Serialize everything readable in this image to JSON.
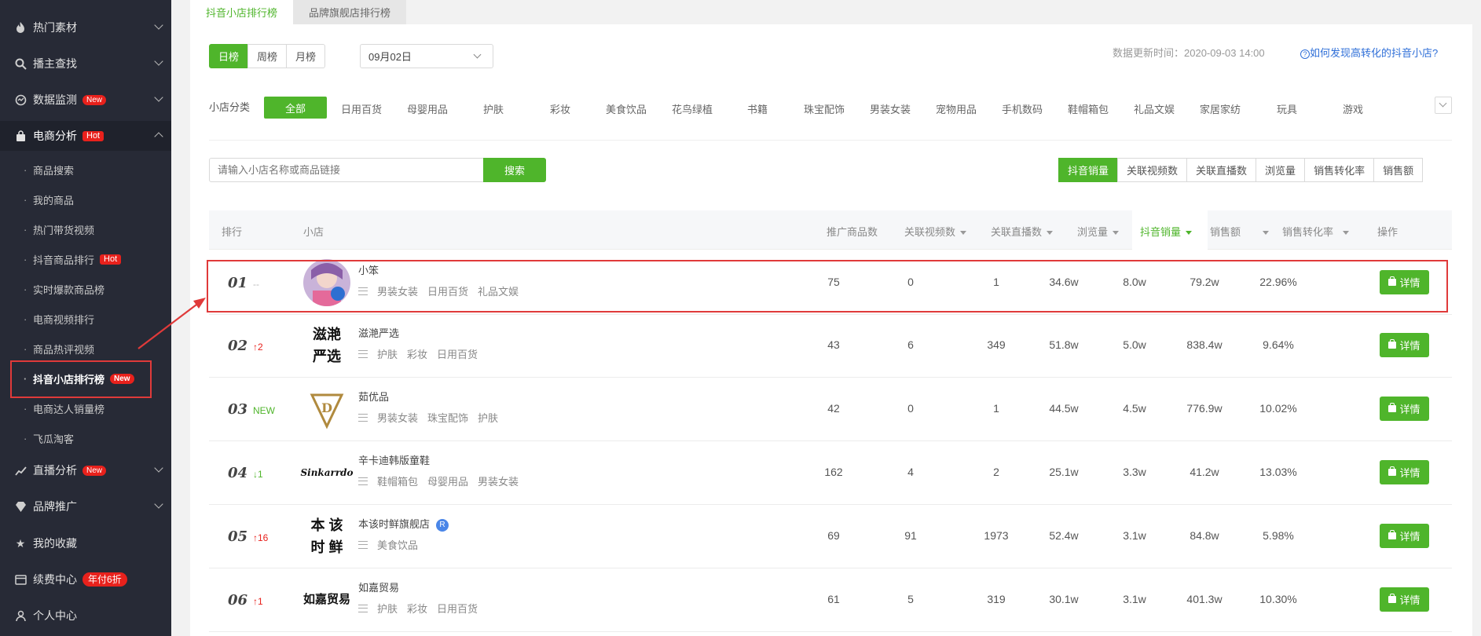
{
  "sidebar": {
    "items": [
      {
        "label": "热门素材",
        "icon": "flame-icon"
      },
      {
        "label": "播主查找",
        "icon": "search-icon"
      },
      {
        "label": "数据监测",
        "icon": "monitor-icon",
        "tag": "New"
      },
      {
        "label": "电商分析",
        "icon": "shopping-bag-icon",
        "tag": "Hot"
      }
    ],
    "sub_items": [
      {
        "label": "商品搜索"
      },
      {
        "label": "我的商品"
      },
      {
        "label": "热门带货视频"
      },
      {
        "label": "抖音商品排行",
        "tag": "Hot"
      },
      {
        "label": "实时爆款商品榜"
      },
      {
        "label": "电商视频排行"
      },
      {
        "label": "商品热评视频"
      },
      {
        "label": "抖音小店排行榜",
        "tag": "New"
      },
      {
        "label": "电商达人销量榜"
      },
      {
        "label": "飞瓜淘客"
      }
    ],
    "bottom_items": [
      {
        "label": "直播分析",
        "icon": "chart-line-icon",
        "tag": "New"
      },
      {
        "label": "品牌推广",
        "icon": "diamond-icon"
      },
      {
        "label": "我的收藏",
        "icon": "star-icon"
      },
      {
        "label": "续费中心",
        "icon": "card-icon",
        "tag": "年付6折"
      },
      {
        "label": "个人中心",
        "icon": "user-icon"
      }
    ]
  },
  "tabs": [
    "抖音小店排行榜",
    "品牌旗舰店排行榜"
  ],
  "period": {
    "options": [
      "日榜",
      "周榜",
      "月榜"
    ],
    "selected": "日榜"
  },
  "date": "09月02日",
  "update_time": "数据更新时间：2020-09-03 14:00",
  "help_link": "如何发现高转化的抖音小店?",
  "category": {
    "label": "小店分类",
    "all": "全部",
    "items": [
      "日用百货",
      "母婴用品",
      "护肤",
      "彩妆",
      "美食饮品",
      "花鸟绿植",
      "书籍",
      "珠宝配饰",
      "男装女装",
      "宠物用品",
      "手机数码",
      "鞋帽箱包",
      "礼品文娱",
      "家居家纺",
      "玩具",
      "游戏"
    ]
  },
  "search": {
    "placeholder": "请输入小店名称或商品链接",
    "button": "搜索"
  },
  "metric_tabs": [
    "抖音销量",
    "关联视频数",
    "关联直播数",
    "浏览量",
    "销售转化率",
    "销售额"
  ],
  "columns": {
    "rank": "排行",
    "shop": "小店",
    "promo": "推广商品数",
    "videos": "关联视频数",
    "lives": "关联直播数",
    "views": "浏览量",
    "sales": "抖音销量",
    "revenue": "销售额",
    "conversion": "销售转化率",
    "action": "操作"
  },
  "detail_label": "详情",
  "rows": [
    {
      "rank": "01",
      "trend": "--",
      "trend_type": "none",
      "name": "小笨",
      "logo_text": "",
      "tags": [
        "男装女装",
        "日用百货",
        "礼品文娱"
      ],
      "promo": "75",
      "videos": "0",
      "lives": "1",
      "views": "34.6w",
      "sales": "8.0w",
      "revenue": "79.2w",
      "conversion": "22.96%"
    },
    {
      "rank": "02",
      "trend": "↑2",
      "trend_type": "up",
      "name": "滋滟严选",
      "logo_text": "滋滟\n严选",
      "tags": [
        "护肤",
        "彩妆",
        "日用百货"
      ],
      "promo": "43",
      "videos": "6",
      "lives": "349",
      "views": "51.8w",
      "sales": "5.0w",
      "revenue": "838.4w",
      "conversion": "9.64%"
    },
    {
      "rank": "03",
      "trend": "NEW",
      "trend_type": "new",
      "name": "茹优品",
      "logo_text": "",
      "tags": [
        "男装女装",
        "珠宝配饰",
        "护肤"
      ],
      "promo": "42",
      "videos": "0",
      "lives": "1",
      "views": "44.5w",
      "sales": "4.5w",
      "revenue": "776.9w",
      "conversion": "10.02%"
    },
    {
      "rank": "04",
      "trend": "↓1",
      "trend_type": "down",
      "name": "辛卡迪韩版童鞋",
      "logo_text": "Sinkarrdo",
      "tags": [
        "鞋帽箱包",
        "母婴用品",
        "男装女装"
      ],
      "promo": "162",
      "videos": "4",
      "lives": "2",
      "views": "25.1w",
      "sales": "3.3w",
      "revenue": "41.2w",
      "conversion": "13.03%"
    },
    {
      "rank": "05",
      "trend": "↑16",
      "trend_type": "up",
      "name": "本该时鲜旗舰店",
      "logo_text": "本 该\n时 鲜",
      "verified": "R",
      "tags": [
        "美食饮品"
      ],
      "promo": "69",
      "videos": "91",
      "lives": "1973",
      "views": "52.4w",
      "sales": "3.1w",
      "revenue": "84.8w",
      "conversion": "5.98%"
    },
    {
      "rank": "06",
      "trend": "↑1",
      "trend_type": "up",
      "name": "如嘉贸易",
      "logo_text": "如嘉贸易",
      "tags": [
        "护肤",
        "彩妆",
        "日用百货"
      ],
      "promo": "61",
      "videos": "5",
      "lives": "319",
      "views": "30.1w",
      "sales": "3.1w",
      "revenue": "401.3w",
      "conversion": "10.30%"
    }
  ],
  "colors": {
    "accent": "#4fb52b",
    "sidebar_bg": "#272a36",
    "highlight": "#e03a3a",
    "hot": "#e8211c"
  }
}
